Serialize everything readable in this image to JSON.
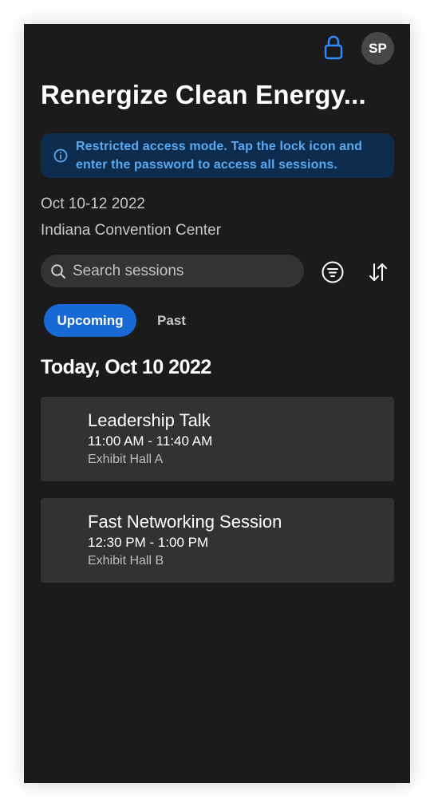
{
  "header": {
    "avatar_initials": "SP",
    "title": "Renergize Clean Energy..."
  },
  "banner": {
    "line1": "Restricted access mode. Tap the lock icon and",
    "line2": "enter the password to access all sessions."
  },
  "event": {
    "dates": "Oct 10-12 2022",
    "venue": "Indiana Convention Center"
  },
  "search": {
    "placeholder": "Search sessions"
  },
  "tabs": [
    {
      "label": "Upcoming",
      "active": true
    },
    {
      "label": "Past",
      "active": false
    }
  ],
  "day_heading": "Today, Oct 10 2022",
  "sessions": [
    {
      "title": "Leadership Talk",
      "time": "11:00 AM - 11:40 AM",
      "room": "Exhibit Hall A"
    },
    {
      "title": "Fast Networking Session",
      "time": "12:30 PM - 1:00 PM",
      "room": "Exhibit Hall B"
    }
  ],
  "icons": {
    "lock": "lock-icon",
    "info": "info-icon",
    "search": "search-icon",
    "filter": "filter-icon",
    "sort": "sort-icon"
  },
  "colors": {
    "background": "#1b1b1b",
    "accent": "#1769d6",
    "lock": "#2d8cff",
    "banner_bg": "#0e2c4d",
    "banner_text": "#5aa9f0",
    "card_bg": "#323232"
  }
}
